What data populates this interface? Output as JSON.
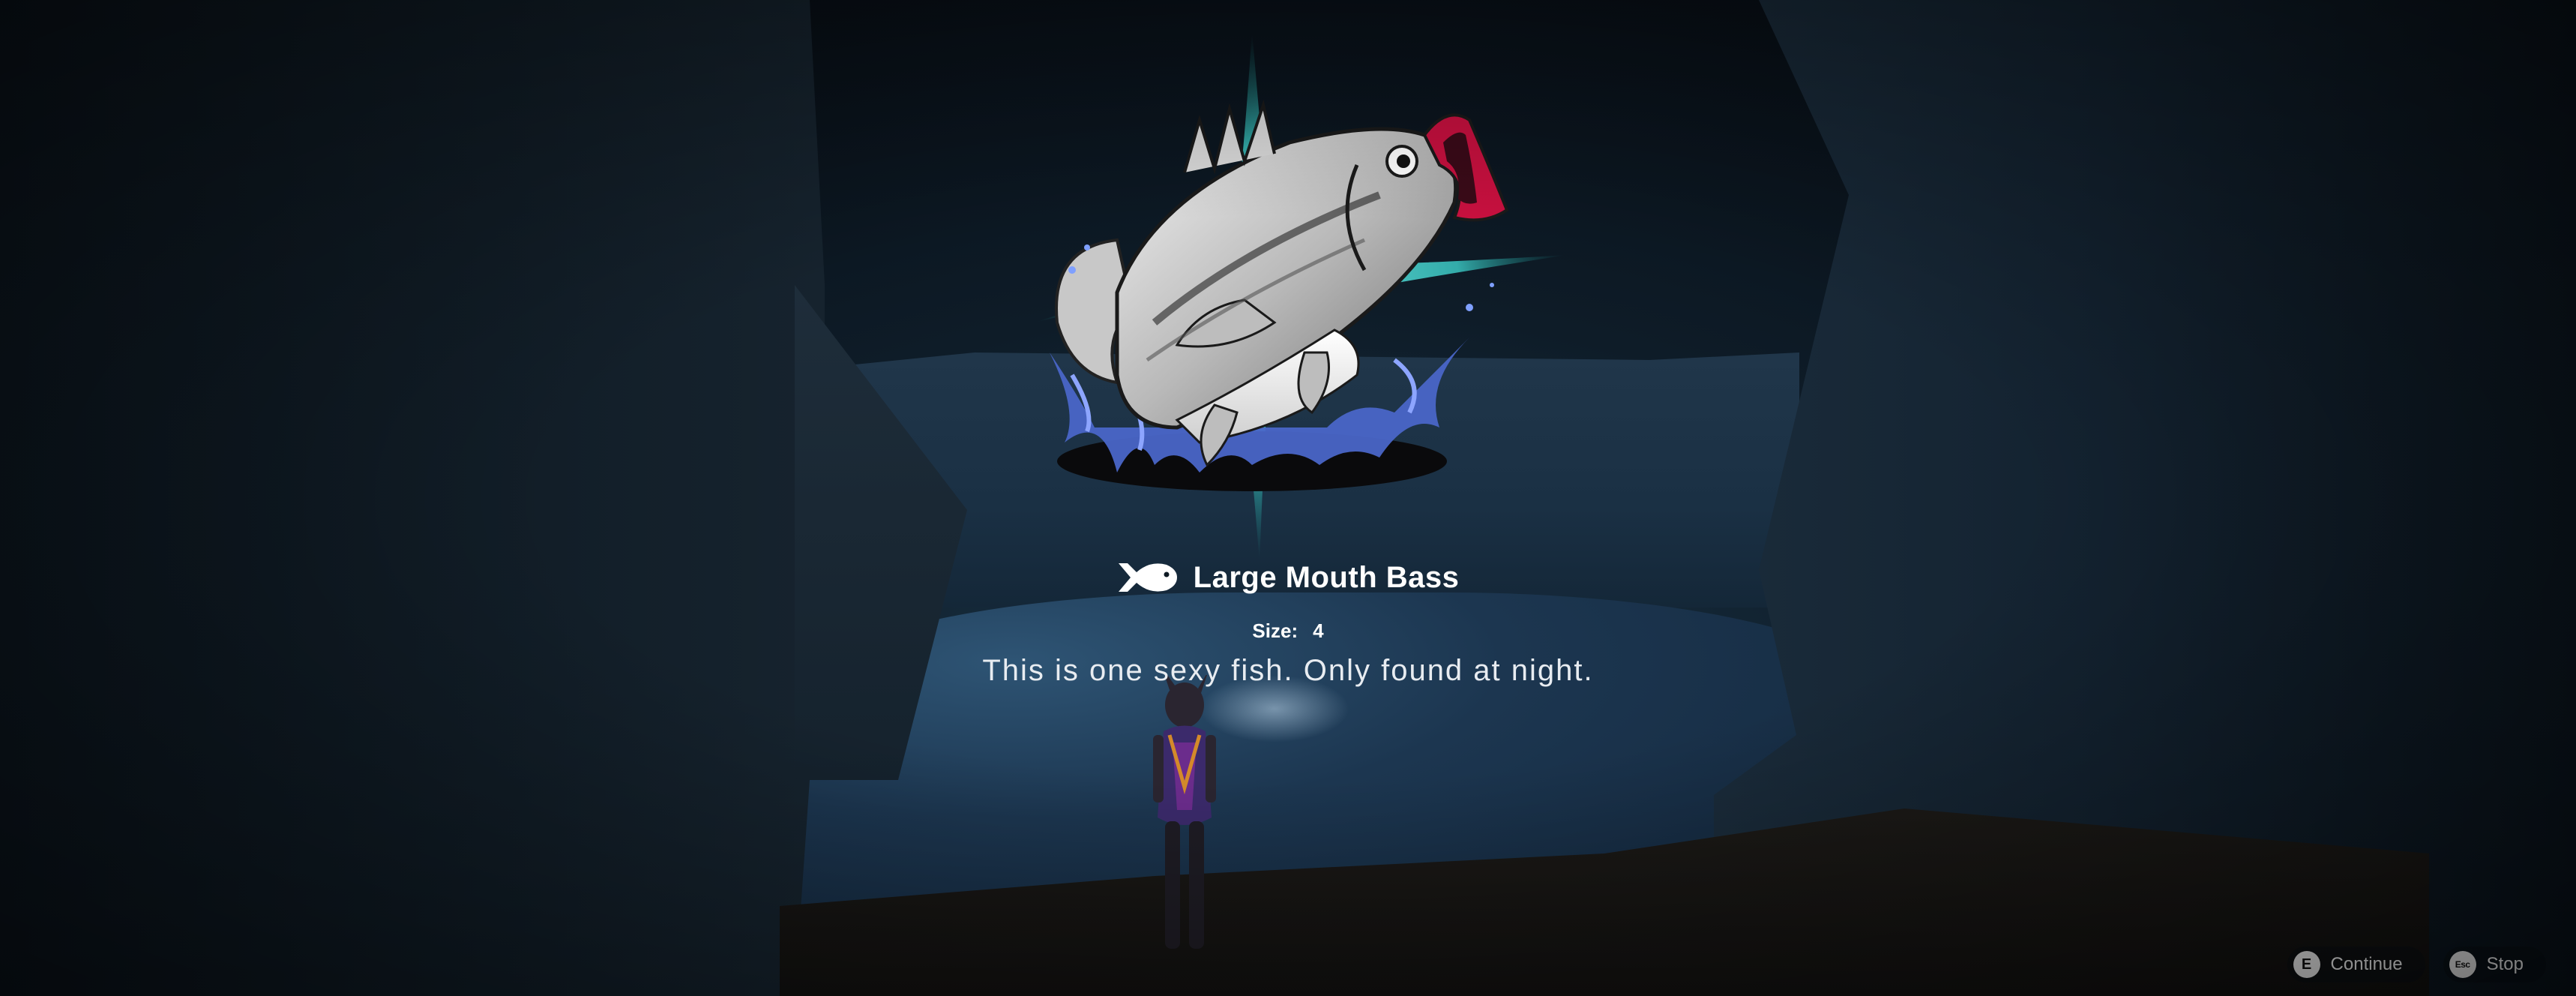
{
  "fish": {
    "name": "Large Mouth Bass",
    "size_label": "Size:",
    "size_value": "4",
    "description": "This is one sexy fish. Only found at night."
  },
  "hints": [
    {
      "key": "E",
      "label": "Continue"
    },
    {
      "key": "Esc",
      "label": "Stop"
    }
  ],
  "colors": {
    "glow": "#3fd8d2",
    "mouth": "#c8103f",
    "splash": "#4a66c8"
  },
  "icons": {
    "title_icon": "fish-icon"
  }
}
